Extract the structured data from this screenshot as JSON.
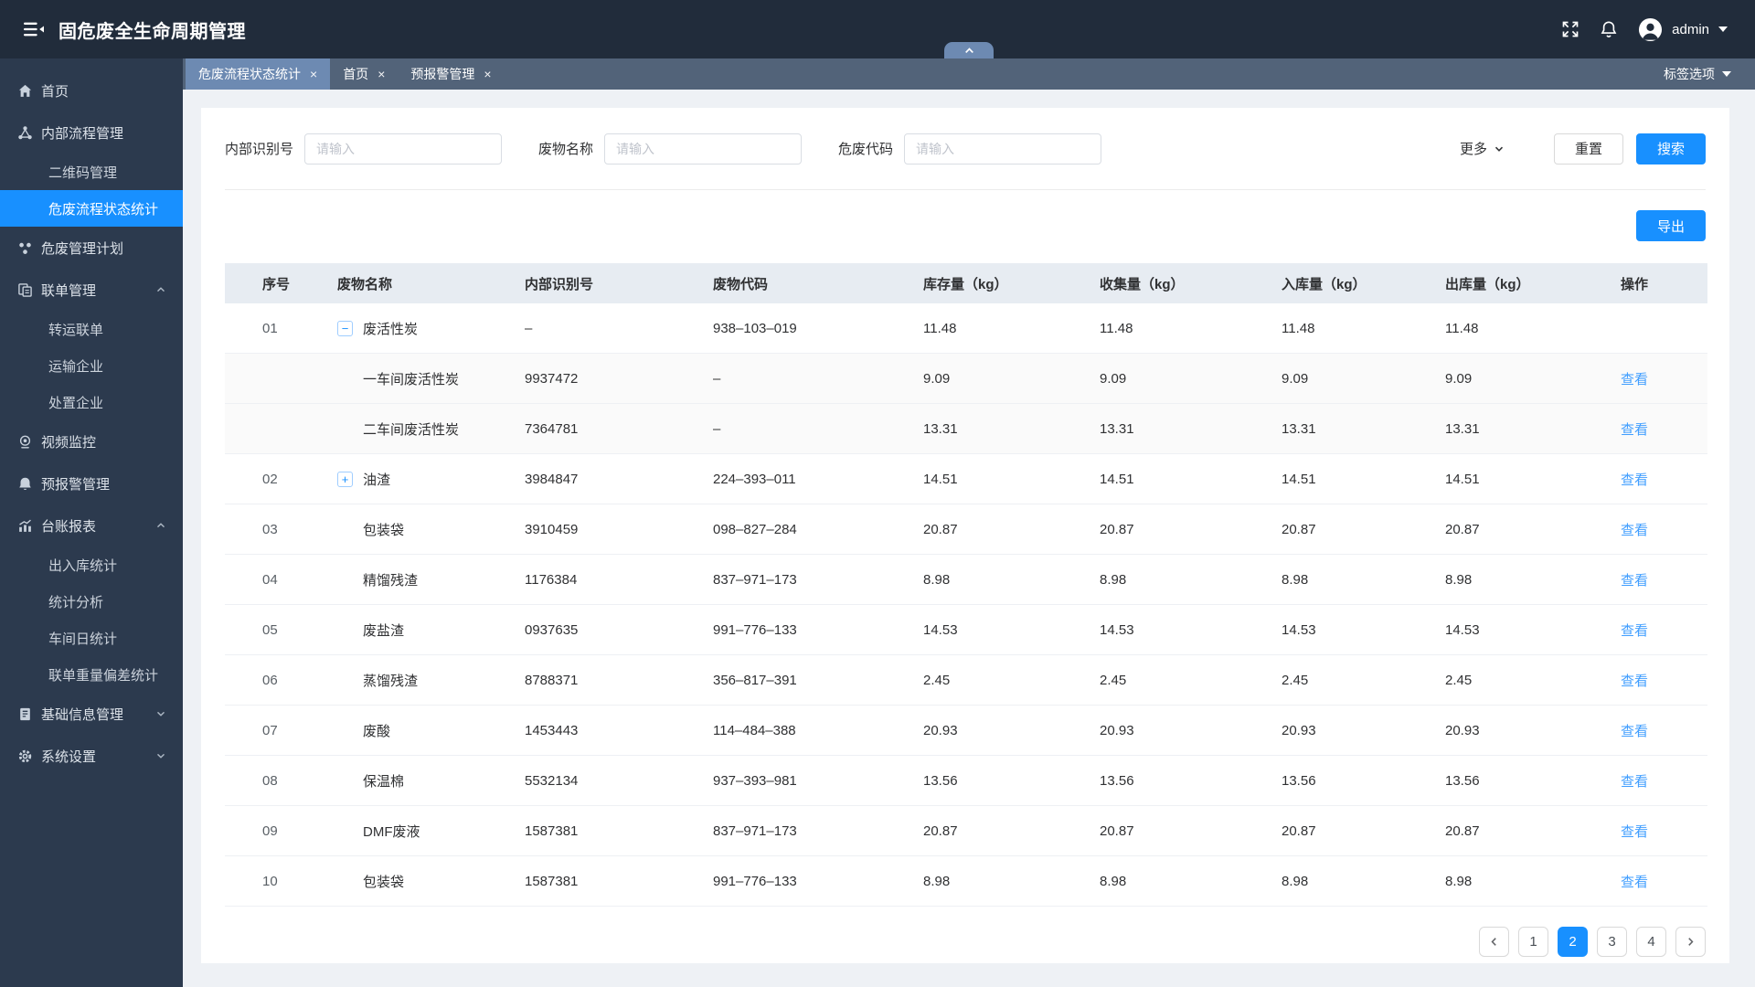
{
  "colors": {
    "accent": "#1890ff",
    "topbar": "#212c3b",
    "sidebar": "#2c3a4e",
    "tabbar": "#526379",
    "tab_active": "#6d8ab2",
    "link": "#409eff"
  },
  "topbar": {
    "title": "固危废全生命周期管理",
    "user": "admin"
  },
  "tabbar": {
    "tabs": [
      {
        "label": "危废流程状态统计",
        "active": true
      },
      {
        "label": "首页",
        "active": false
      },
      {
        "label": "预报警管理",
        "active": false
      }
    ],
    "options_label": "标签选项"
  },
  "sidebar": {
    "items": [
      {
        "label": "首页",
        "icon": "home"
      },
      {
        "label": "内部流程管理",
        "icon": "flow",
        "children": [
          {
            "label": "二维码管理"
          },
          {
            "label": "危废流程状态统计",
            "active": true
          }
        ]
      },
      {
        "label": "危废管理计划",
        "icon": "plan"
      },
      {
        "label": "联单管理",
        "icon": "manifest",
        "chevron": "up",
        "children": [
          {
            "label": "转运联单"
          },
          {
            "label": "运输企业"
          },
          {
            "label": "处置企业"
          }
        ]
      },
      {
        "label": "视频监控",
        "icon": "camera"
      },
      {
        "label": "预报警管理",
        "icon": "alarm"
      },
      {
        "label": "台账报表",
        "icon": "chart",
        "chevron": "up",
        "children": [
          {
            "label": "出入库统计"
          },
          {
            "label": "统计分析"
          },
          {
            "label": "车间日统计"
          },
          {
            "label": "联单重量偏差统计"
          }
        ]
      },
      {
        "label": "基础信息管理",
        "icon": "doc",
        "chevron": "down"
      },
      {
        "label": "系统设置",
        "icon": "gear",
        "chevron": "down"
      }
    ]
  },
  "search": {
    "fields": [
      {
        "label": "内部识别号",
        "placeholder": "请输入",
        "value": ""
      },
      {
        "label": "废物名称",
        "placeholder": "请输入",
        "value": ""
      },
      {
        "label": "危废代码",
        "placeholder": "请输入",
        "value": ""
      }
    ],
    "more_label": "更多",
    "reset_label": "重置",
    "search_label": "搜索"
  },
  "toolbar": {
    "export_label": "导出"
  },
  "table": {
    "columns": [
      "序号",
      "废物名称",
      "内部识别号",
      "废物代码",
      "库存量（kg）",
      "收集量（kg）",
      "入库量（kg）",
      "出库量（kg）",
      "操作"
    ],
    "action_label": "查看",
    "rows": [
      {
        "no": "01",
        "expander": "minus",
        "sub": false,
        "name": "废活性炭",
        "id": "–",
        "code": "938–103–019",
        "stock": "11.48",
        "collected": "11.48",
        "inbound": "11.48",
        "outbound": "11.48",
        "action": false
      },
      {
        "no": "",
        "expander": "",
        "sub": true,
        "name": "一车间废活性炭",
        "id": "9937472",
        "code": "–",
        "stock": "9.09",
        "collected": "9.09",
        "inbound": "9.09",
        "outbound": "9.09",
        "action": true
      },
      {
        "no": "",
        "expander": "",
        "sub": true,
        "name": "二车间废活性炭",
        "id": "7364781",
        "code": "–",
        "stock": "13.31",
        "collected": "13.31",
        "inbound": "13.31",
        "outbound": "13.31",
        "action": true
      },
      {
        "no": "02",
        "expander": "plus",
        "sub": false,
        "name": "油渣",
        "id": "3984847",
        "code": "224–393–011",
        "stock": "14.51",
        "collected": "14.51",
        "inbound": "14.51",
        "outbound": "14.51",
        "action": true
      },
      {
        "no": "03",
        "expander": "",
        "sub": false,
        "name": "包装袋",
        "id": "3910459",
        "code": "098–827–284",
        "stock": "20.87",
        "collected": "20.87",
        "inbound": "20.87",
        "outbound": "20.87",
        "action": true
      },
      {
        "no": "04",
        "expander": "",
        "sub": false,
        "name": "精馏残渣",
        "id": "1176384",
        "code": "837–971–173",
        "stock": "8.98",
        "collected": "8.98",
        "inbound": "8.98",
        "outbound": "8.98",
        "action": true
      },
      {
        "no": "05",
        "expander": "",
        "sub": false,
        "name": "废盐渣",
        "id": "0937635",
        "code": "991–776–133",
        "stock": "14.53",
        "collected": "14.53",
        "inbound": "14.53",
        "outbound": "14.53",
        "action": true
      },
      {
        "no": "06",
        "expander": "",
        "sub": false,
        "name": "蒸馏残渣",
        "id": "8788371",
        "code": "356–817–391",
        "stock": "2.45",
        "collected": "2.45",
        "inbound": "2.45",
        "outbound": "2.45",
        "action": true
      },
      {
        "no": "07",
        "expander": "",
        "sub": false,
        "name": "废酸",
        "id": "1453443",
        "code": "114–484–388",
        "stock": "20.93",
        "collected": "20.93",
        "inbound": "20.93",
        "outbound": "20.93",
        "action": true
      },
      {
        "no": "08",
        "expander": "",
        "sub": false,
        "name": "保温棉",
        "id": "5532134",
        "code": "937–393–981",
        "stock": "13.56",
        "collected": "13.56",
        "inbound": "13.56",
        "outbound": "13.56",
        "action": true
      },
      {
        "no": "09",
        "expander": "",
        "sub": false,
        "name": "DMF废液",
        "id": "1587381",
        "code": "837–971–173",
        "stock": "20.87",
        "collected": "20.87",
        "inbound": "20.87",
        "outbound": "20.87",
        "action": true
      },
      {
        "no": "10",
        "expander": "",
        "sub": false,
        "name": "包装袋",
        "id": "1587381",
        "code": "991–776–133",
        "stock": "8.98",
        "collected": "8.98",
        "inbound": "8.98",
        "outbound": "8.98",
        "action": true
      }
    ]
  },
  "pagination": {
    "pages": [
      "1",
      "2",
      "3",
      "4"
    ],
    "active_page": "2"
  }
}
